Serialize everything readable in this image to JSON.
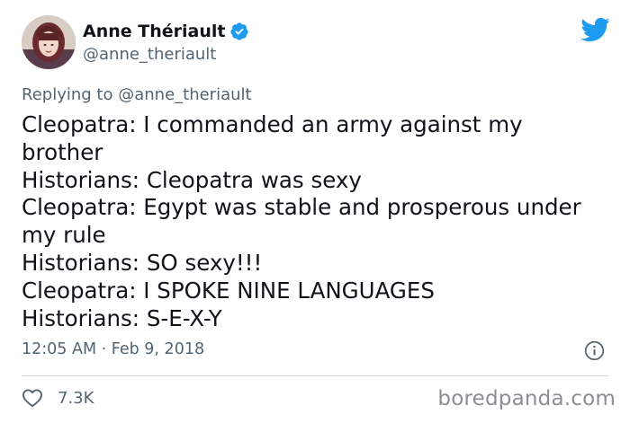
{
  "author": {
    "display_name": "Anne Thériault",
    "handle": "@anne_theriault",
    "avatar": "profile-photo",
    "verified_icon": "verified-badge-icon"
  },
  "reply": {
    "prefix": "Replying to",
    "handle": "@anne_theriault"
  },
  "tweet": {
    "lines": [
      "Cleopatra: I commanded an army against my",
      "brother",
      "Historians: Cleopatra was sexy",
      "Cleopatra: Egypt was stable and prosperous under",
      "my rule",
      "Historians: SO sexy!!!",
      "Cleopatra: I SPOKE NINE LANGUAGES",
      "Historians: S-E-X-Y"
    ],
    "timestamp": "12:05 AM · Feb 9, 2018"
  },
  "actions": {
    "like_count": "7.3K",
    "like_icon": "heart-icon",
    "info_icon": "info-icon"
  },
  "brand": {
    "icon": "twitter-bird-icon",
    "color": "#1d9bf0"
  },
  "watermark": "boredpanda.com"
}
